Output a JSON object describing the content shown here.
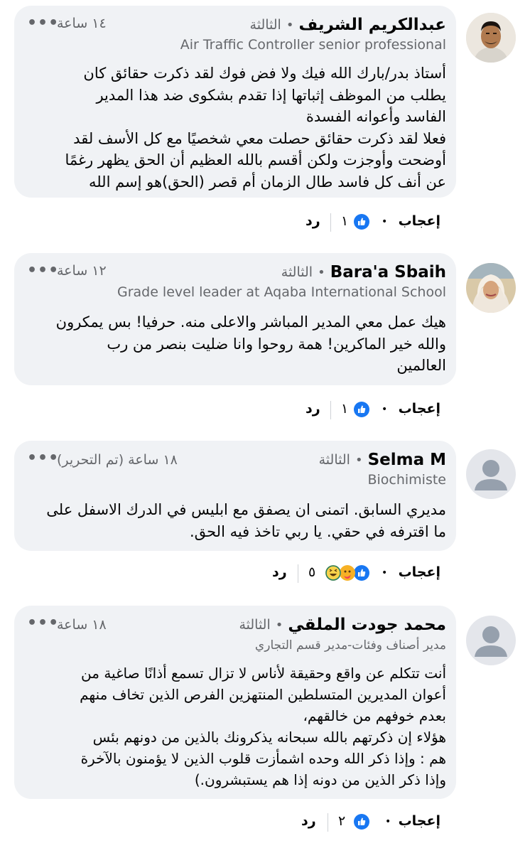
{
  "colors": {
    "bubble": "#f0f2f5",
    "meta": "#65676b",
    "like_blue": "#1877f2",
    "text": "#050505"
  },
  "comments": [
    {
      "name": "عبدالكريم الشريف",
      "separator": "•",
      "day": "الثالثة",
      "time": "١٤ ساعة",
      "more": "•••",
      "subtitle": "Air Traffic Controller senior professional",
      "lines": [
        "أستاذ بدر/بارك الله فيك ولا فض فوك لقد ذكرت حقائق كان",
        "يطلب من الموظف إثباتها إذا تقدم بشكوى ضد هذا المدير",
        "الفاسد وأعوانه الفسدة",
        "فعلا لقد ذكرت حقائق حصلت معي شخصيًا مع كل الأسف لقد",
        "أوضحت وأوجزت ولكن أقسم بالله العظيم أن الحق يظهر رغمًا",
        "عن أنف كل فاسد طال الزمان أم قصر (الحق)هو إسم الله"
      ],
      "like": "إعجاب",
      "dot": "•",
      "count": "١",
      "reply": "رد",
      "avatar": "photo-man"
    },
    {
      "name": "Bara'a Sbaih",
      "separator": "•",
      "day": "الثالثة",
      "time": "١٢ ساعة",
      "more": "•••",
      "subtitle": "Grade level leader at Aqaba International School",
      "lines": [
        "هيك عمل معي المدير المباشر والاعلى منه. حرفيا! بس يمكرون",
        "والله خير الماكرين! همة روحوا وانا ضليت بنصر من رب",
        "العالمين"
      ],
      "like": "إعجاب",
      "dot": "•",
      "count": "١",
      "reply": "رد",
      "avatar": "photo-woman"
    },
    {
      "name": "Selma M",
      "separator": "•",
      "day": "الثالثة",
      "time": "١٨ ساعة (تم التحرير)",
      "more": "•••",
      "subtitle": "Biochimiste",
      "lines": [
        "مديري السابق. اتمنى ان يصفق مع ابليس في الدرك الاسفل على",
        "ما اقترفه في حقي. يا ربي تاخذ فيه الحق."
      ],
      "like": "إعجاب",
      "dot": "•",
      "count": "٥",
      "reply": "رد",
      "avatar": "default-avatar"
    },
    {
      "name": "محمد جودت الملقي",
      "separator": "•",
      "day": "الثالثة",
      "time": "١٨ ساعة",
      "more": "•••",
      "subtitle": "مدير أصناف وفئات-مدير قسم التجاري",
      "lines": [
        "أنت تتكلم عن واقع وحقيقة لأناس لا تزال تسمع أذانًا صاغية من",
        "أعوان المديرين المتسلطين المنتهزين الفرص الذين تخاف منهم",
        "بعدم خوفهم من خالقهم،",
        "هؤلاء إن ذكرتهم بالله سبحانه يذكرونك بالذين من دونهم بئس",
        "هم : وإذا ذكر الله وحده اشمأزت  قلوب الذين لا يؤمنون بالآخرة",
        "وإذا ذكر الذين من دونه إذا هم يستبشرون.)"
      ],
      "like": "إعجاب",
      "dot": "•",
      "count": "٢",
      "reply": "رد",
      "avatar": "default-avatar"
    }
  ]
}
